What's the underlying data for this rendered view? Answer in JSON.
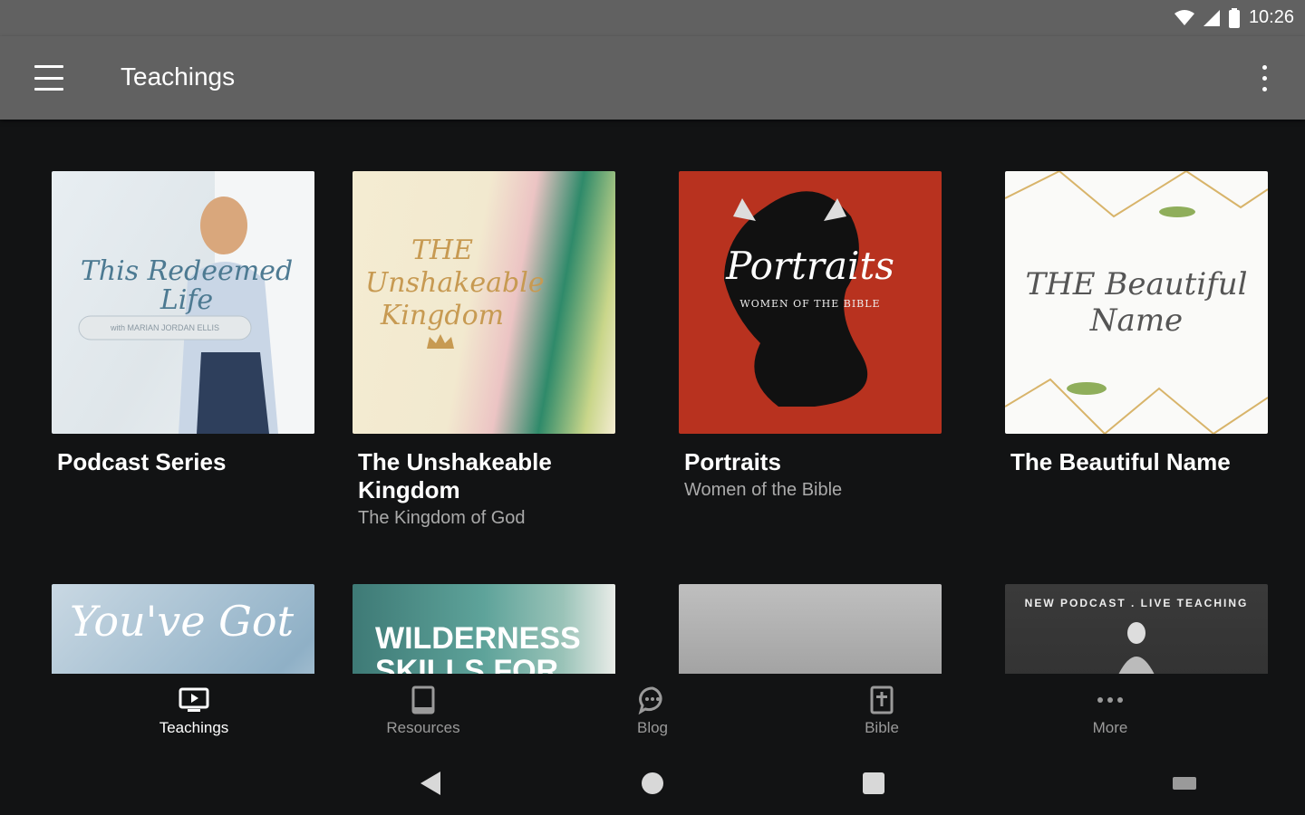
{
  "status": {
    "time": "10:26"
  },
  "appbar": {
    "title": "Teachings"
  },
  "cards": [
    {
      "title": "Podcast Series",
      "subtitle": "",
      "art_title": "This Redeemed Life",
      "art_sub": "with MARIAN JORDAN ELLIS"
    },
    {
      "title": "The Unshakeable Kingdom",
      "subtitle": "The Kingdom of God",
      "art_title": "THE Unshakeable Kingdom"
    },
    {
      "title": "Portraits",
      "subtitle": "Women of the Bible",
      "art_title": "Portraits",
      "art_sub": "WOMEN OF THE BIBLE"
    },
    {
      "title": "The Beautiful Name",
      "subtitle": "",
      "art_title": "THE Beautiful Name"
    },
    {
      "art_title": "You've Got"
    },
    {
      "art_title": "WILDERNESS SKILLS FOR"
    },
    {
      "art_title": ""
    },
    {
      "art_title": "NEW PODCAST . LIVE TEACHING"
    }
  ],
  "bottom_nav": [
    {
      "label": "Teachings",
      "icon": "tv-icon"
    },
    {
      "label": "Resources",
      "icon": "book-icon"
    },
    {
      "label": "Blog",
      "icon": "chat-bubble-icon"
    },
    {
      "label": "Bible",
      "icon": "bible-icon"
    },
    {
      "label": "More",
      "icon": "more-dots-icon"
    }
  ],
  "colors": {
    "appbar": "#616161",
    "background": "#121314",
    "active_nav": "#ffffff",
    "inactive_nav": "#9a9a9a"
  }
}
